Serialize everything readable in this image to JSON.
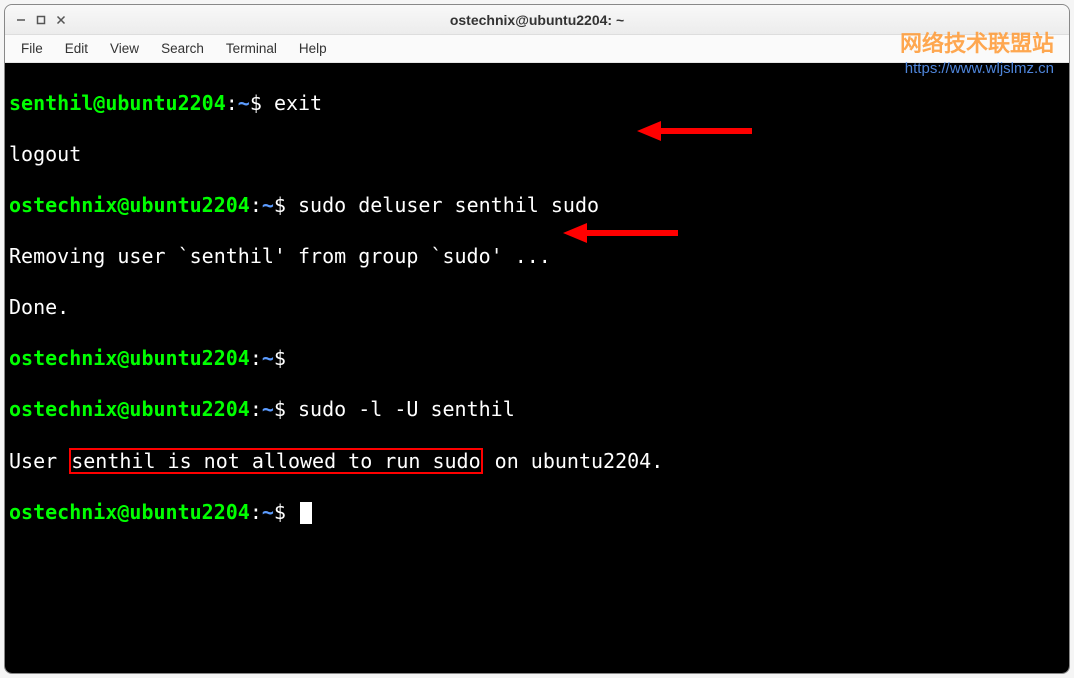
{
  "window": {
    "title": "ostechnix@ubuntu2204: ~"
  },
  "menubar": {
    "items": [
      "File",
      "Edit",
      "View",
      "Search",
      "Terminal",
      "Help"
    ]
  },
  "terminal": {
    "lines": [
      {
        "prompt_user": "senthil@ubuntu2204",
        "prompt_path": "~",
        "command": "exit"
      },
      {
        "output": "logout"
      },
      {
        "prompt_user": "ostechnix@ubuntu2204",
        "prompt_path": "~",
        "command": "sudo deluser senthil sudo",
        "arrow": true
      },
      {
        "output": "Removing user `senthil' from group `sudo' ..."
      },
      {
        "output": "Done."
      },
      {
        "prompt_user": "ostechnix@ubuntu2204",
        "prompt_path": "~",
        "command": ""
      },
      {
        "prompt_user": "ostechnix@ubuntu2204",
        "prompt_path": "~",
        "command": "sudo -l -U senthil",
        "arrow": true
      },
      {
        "output_pre": "User ",
        "output_highlight": "senthil is not allowed to run sudo",
        "output_post": " on ubuntu2204."
      },
      {
        "prompt_user": "ostechnix@ubuntu2204",
        "prompt_path": "~",
        "command": "",
        "cursor": true
      }
    ]
  },
  "watermark": {
    "text": "网络技术联盟站",
    "url": "https://www.wljslmz.cn"
  },
  "colors": {
    "prompt_user": "#00ff00",
    "prompt_path": "#5c9cff",
    "terminal_bg": "#000000",
    "terminal_fg": "#ffffff",
    "highlight_border": "#ff0000",
    "arrow": "#ff0000",
    "watermark_text": "#ff9933",
    "watermark_url": "#5c9cff"
  }
}
